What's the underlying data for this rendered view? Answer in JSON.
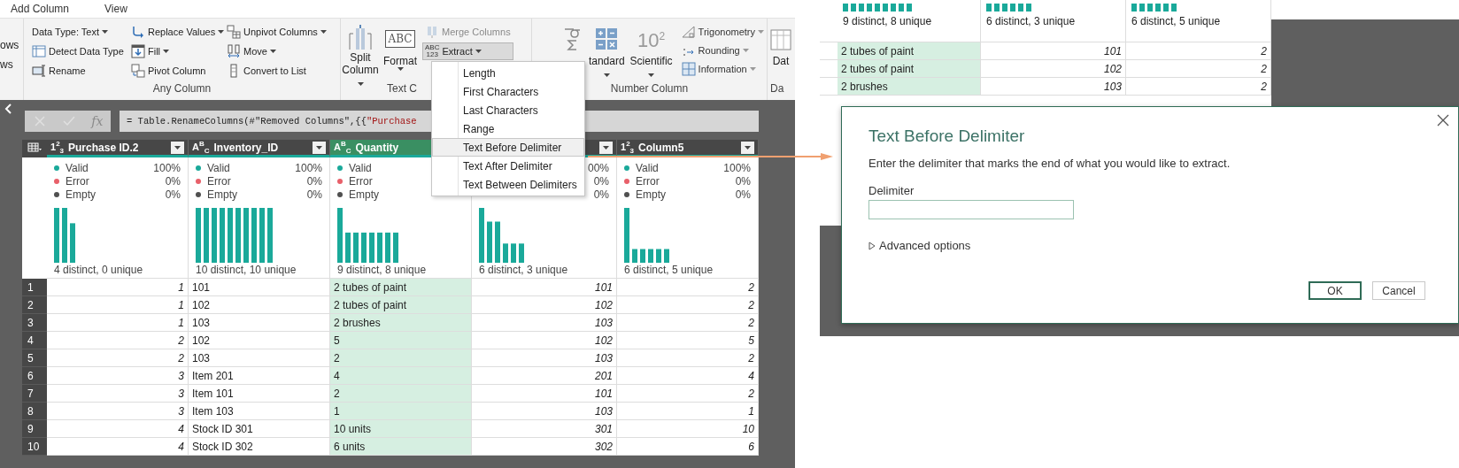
{
  "tabs": [
    {
      "label": "Add Column"
    },
    {
      "label": "View"
    }
  ],
  "ribbon": {
    "cut_items": [
      "ows",
      "ws"
    ],
    "any_column": {
      "label": "Any Column",
      "items": [
        {
          "label": "Data Type: Text",
          "dropdown": true
        },
        {
          "label": "Detect Data Type",
          "dropdown": false
        },
        {
          "label": "Rename",
          "dropdown": false
        },
        {
          "label": "Replace Values",
          "dropdown": true
        },
        {
          "label": "Fill",
          "dropdown": true
        },
        {
          "label": "Pivot Column",
          "dropdown": false
        },
        {
          "label": "Unpivot Columns",
          "dropdown": true
        },
        {
          "label": "Move",
          "dropdown": true
        },
        {
          "label": "Convert to List",
          "dropdown": false
        }
      ]
    },
    "text_column": {
      "label": "Text C",
      "split": {
        "label": "Split Column",
        "dropdown": true
      },
      "format": {
        "label": "Format",
        "icon_text": "ABC",
        "dropdown": true
      },
      "merge": {
        "label": "Merge Columns",
        "disabled": true
      },
      "extract": {
        "label": "Extract",
        "icon_lines": [
          "ABC",
          "123"
        ],
        "pressed": true,
        "dropdown": true
      }
    },
    "number_column": {
      "label": "Number Column",
      "large": [
        {
          "label": "tandard",
          "dropdown": true
        },
        {
          "label": "Scientific",
          "icon_text": "10$^{2}$",
          "dropdown": true
        }
      ],
      "small": [
        {
          "label": "Trigonometry",
          "dropdown": true
        },
        {
          "label": "Rounding",
          "dropdown": true
        },
        {
          "label": "Information",
          "dropdown": true
        }
      ]
    },
    "date_group": {
      "button": "Dat",
      "label": "Da"
    }
  },
  "formula_bar": {
    "fx": "fx",
    "code": "= Table.RenameColumns(#\"Removed Columns\",{{",
    "string_start": "\"Purchase"
  },
  "table": {
    "columns": [
      {
        "type_icon": "1$^{2}$$_{3}$",
        "name": "Purchase ID.2",
        "filter_button": true,
        "kind": "number",
        "selected": false,
        "summary": "4 distinct, 0 unique",
        "stats": [
          {
            "label": "Valid",
            "value": "100%",
            "color": "#1aa99a"
          },
          {
            "label": "Error",
            "value": "0%",
            "color": "#e8606a"
          },
          {
            "label": "Empty",
            "value": "0%",
            "color": "#505050"
          }
        ]
      },
      {
        "type_icon": "A$^{B}$$_{C}$",
        "name": "Inventory_ID",
        "filter_button": true,
        "kind": "text",
        "selected": false,
        "summary": "10 distinct, 10 unique",
        "stats": [
          {
            "label": "Valid",
            "value": "100%",
            "color": "#1aa99a"
          },
          {
            "label": "Error",
            "value": "0%",
            "color": "#e8606a"
          },
          {
            "label": "Empty",
            "value": "0%",
            "color": "#505050"
          }
        ]
      },
      {
        "type_icon": "A$^{B}$$_{C}$",
        "name": "Quantity",
        "filter_button": false,
        "kind": "text",
        "selected": true,
        "summary": "9 distinct, 8 unique",
        "stats": [
          {
            "label": "Valid",
            "color": "#1aa99a"
          },
          {
            "label": "Error",
            "color": "#e8606a"
          },
          {
            "label": "Empty",
            "color": "#505050"
          }
        ]
      },
      {
        "filter_button": true,
        "kind": "number",
        "selected": false,
        "summary": "6 distinct, 3 unique",
        "stats": [
          {
            "value": "00%"
          },
          {
            "value": "0%"
          },
          {
            "value": "0%"
          }
        ]
      },
      {
        "type_icon": "1$^{2}$$_{3}$",
        "name": "Column5",
        "filter_button": true,
        "kind": "number",
        "selected": false,
        "summary": "6 distinct, 5 unique",
        "stats": [
          {
            "label": "Valid",
            "value": "100%",
            "color": "#1aa99a"
          },
          {
            "label": "Error",
            "value": "0%",
            "color": "#e8606a"
          },
          {
            "label": "Empty",
            "value": "0%",
            "color": "#505050"
          }
        ]
      }
    ],
    "rows": [
      {
        "number": "1",
        "cells": [
          "1",
          "101",
          "2 tubes of paint",
          "101",
          "2"
        ]
      },
      {
        "number": "2",
        "cells": [
          "1",
          "102",
          "2 tubes of paint",
          "102",
          "2"
        ]
      },
      {
        "number": "3",
        "cells": [
          "1",
          "103",
          "2 brushes",
          "103",
          "2"
        ]
      },
      {
        "number": "4",
        "cells": [
          "2",
          "102",
          "5",
          "102",
          "5"
        ]
      },
      {
        "number": "5",
        "cells": [
          "2",
          "103",
          "2",
          "103",
          "2"
        ]
      },
      {
        "number": "6",
        "cells": [
          "3",
          "Item 201",
          "4",
          "201",
          "4"
        ]
      },
      {
        "number": "7",
        "cells": [
          "3",
          "Item 101",
          "2",
          "101",
          "2"
        ]
      },
      {
        "number": "8",
        "cells": [
          "3",
          "Item 103",
          "1",
          "103",
          "1"
        ]
      },
      {
        "number": "9",
        "cells": [
          "4",
          "Stock ID 301",
          "10 units",
          "301",
          "10"
        ]
      },
      {
        "number": "10",
        "cells": [
          "4",
          "Stock ID 302",
          "6 units",
          "302",
          "6"
        ]
      }
    ]
  },
  "menu": {
    "items": [
      {
        "label": "Length",
        "selected": false
      },
      {
        "label": "First Characters",
        "selected": false
      },
      {
        "label": "Last Characters",
        "selected": false
      },
      {
        "label": "Range",
        "selected": false
      },
      {
        "label": "Text Before Delimiter",
        "selected": true
      },
      {
        "label": "Text After Delimiter",
        "selected": false
      },
      {
        "label": "Text Between Delimiters",
        "selected": false
      }
    ]
  },
  "inset": {
    "columns": [
      {
        "summary": "9 distinct, 8 unique",
        "kind": "text",
        "selected": true
      },
      {
        "summary": "6 distinct, 3 unique",
        "kind": "number",
        "selected": false
      },
      {
        "summary": "6 distinct, 5 unique",
        "kind": "number",
        "selected": false
      }
    ],
    "rows": [
      [
        "2 tubes of paint",
        "101",
        "2"
      ],
      [
        "2 tubes of paint",
        "102",
        "2"
      ],
      [
        "2 brushes",
        "103",
        "2"
      ]
    ]
  },
  "dialog": {
    "title": "Text Before Delimiter",
    "description": "Enter the delimiter that marks the end of what you would like to extract.",
    "field_label": "Delimiter",
    "advanced": {
      "label": "Advanced options",
      "expanded": false
    },
    "buttons": [
      {
        "label": "OK",
        "default": true
      },
      {
        "label": "Cancel",
        "default": false
      }
    ]
  }
}
